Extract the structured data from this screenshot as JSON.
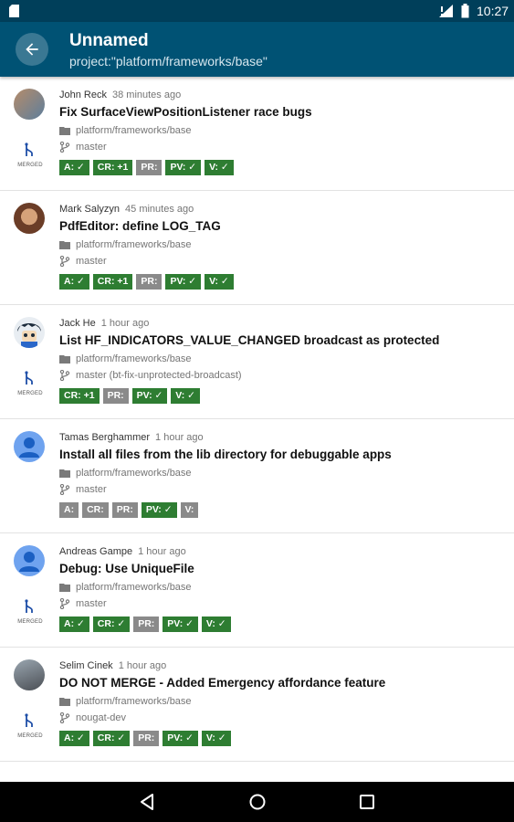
{
  "status_bar": {
    "time": "10:27"
  },
  "app_bar": {
    "title": "Unnamed",
    "subtitle": "project:\"platform/frameworks/base\""
  },
  "merged_label": "MERGED",
  "changes": [
    {
      "owner": "John Reck",
      "ago": "38 minutes ago",
      "subject": "Fix SurfaceViewPositionListener race bugs",
      "project": "platform/frameworks/base",
      "branch": "master",
      "merged": true,
      "avatar": "photo1",
      "labels": [
        {
          "text": "A: ✓",
          "state": "ok"
        },
        {
          "text": "CR: +1",
          "state": "ok"
        },
        {
          "text": "PR:",
          "state": "none"
        },
        {
          "text": "PV: ✓",
          "state": "ok"
        },
        {
          "text": "V: ✓",
          "state": "ok"
        }
      ]
    },
    {
      "owner": "Mark Salyzyn",
      "ago": "45 minutes ago",
      "subject": "PdfEditor: define LOG_TAG",
      "project": "platform/frameworks/base",
      "branch": "master",
      "merged": false,
      "avatar": "photo2",
      "labels": [
        {
          "text": "A: ✓",
          "state": "ok"
        },
        {
          "text": "CR: +1",
          "state": "ok"
        },
        {
          "text": "PR:",
          "state": "none"
        },
        {
          "text": "PV: ✓",
          "state": "ok"
        },
        {
          "text": "V: ✓",
          "state": "ok"
        }
      ]
    },
    {
      "owner": "Jack He",
      "ago": "1 hour ago",
      "subject": "List HF_INDICATORS_VALUE_CHANGED broadcast as protected",
      "project": "platform/frameworks/base",
      "branch": "master (bt-fix-unprotected-broadcast)",
      "merged": true,
      "avatar": "anime",
      "labels": [
        {
          "text": "CR: +1",
          "state": "ok"
        },
        {
          "text": "PR:",
          "state": "none"
        },
        {
          "text": "PV: ✓",
          "state": "ok"
        },
        {
          "text": "V: ✓",
          "state": "ok"
        }
      ]
    },
    {
      "owner": "Tamas Berghammer",
      "ago": "1 hour ago",
      "subject": "Install all files from the lib directory for debuggable apps",
      "project": "platform/frameworks/base",
      "branch": "master",
      "merged": false,
      "avatar": "default",
      "labels": [
        {
          "text": "A:",
          "state": "none"
        },
        {
          "text": "CR:",
          "state": "none"
        },
        {
          "text": "PR:",
          "state": "none"
        },
        {
          "text": "PV: ✓",
          "state": "ok"
        },
        {
          "text": "V:",
          "state": "none"
        }
      ]
    },
    {
      "owner": "Andreas Gampe",
      "ago": "1 hour ago",
      "subject": "Debug: Use UniqueFile",
      "project": "platform/frameworks/base",
      "branch": "master",
      "merged": true,
      "avatar": "default",
      "labels": [
        {
          "text": "A: ✓",
          "state": "ok"
        },
        {
          "text": "CR: ✓",
          "state": "ok"
        },
        {
          "text": "PR:",
          "state": "none"
        },
        {
          "text": "PV: ✓",
          "state": "ok"
        },
        {
          "text": "V: ✓",
          "state": "ok"
        }
      ]
    },
    {
      "owner": "Selim Cinek",
      "ago": "1 hour ago",
      "subject": "DO NOT MERGE - Added Emergency affordance feature",
      "project": "platform/frameworks/base",
      "branch": "nougat-dev",
      "merged": true,
      "avatar": "photo3",
      "labels": [
        {
          "text": "A: ✓",
          "state": "ok"
        },
        {
          "text": "CR: ✓",
          "state": "ok"
        },
        {
          "text": "PR:",
          "state": "none"
        },
        {
          "text": "PV: ✓",
          "state": "ok"
        },
        {
          "text": "V: ✓",
          "state": "ok"
        }
      ]
    }
  ],
  "colors": {
    "status_bar": "#003f5a",
    "app_bar": "#005274",
    "label_ok": "#2e7d32",
    "label_none": "#8a8a8a"
  }
}
